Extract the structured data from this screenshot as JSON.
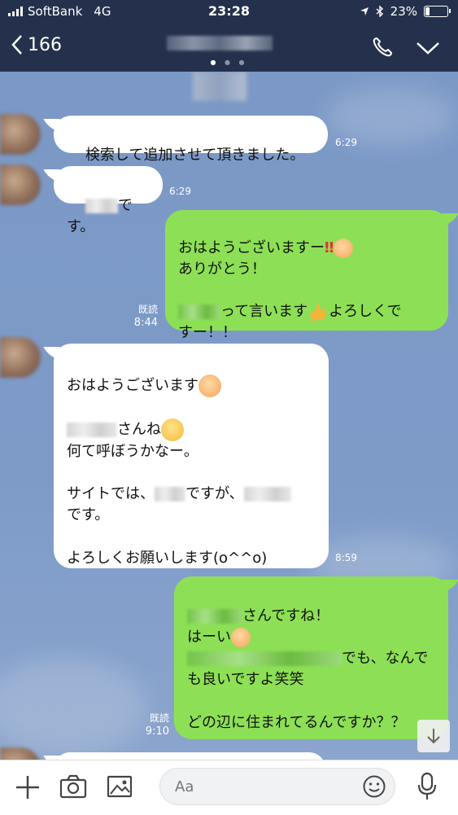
{
  "status": {
    "carrier": "SoftBank",
    "network": "4G",
    "time": "23:28",
    "battery": "23%"
  },
  "header": {
    "back_count": "166"
  },
  "messages": [
    {
      "side": "left",
      "text": "検索して追加させて頂きました。",
      "time": "6:29"
    },
    {
      "side": "left",
      "text": "です。",
      "time": "6:29"
    },
    {
      "side": "right",
      "line1": "おはようございますー",
      "line2": "ありがとう！",
      "line3a": "って言います",
      "line3b": "よろしくで",
      "line4": "すー！！",
      "read": "既読",
      "time": "8:44"
    },
    {
      "side": "left",
      "line1": "おはようございます",
      "line2": "さんね",
      "line3": "何て呼ぼうかなー。",
      "line4a": "サイトでは、",
      "line4b": "ですが、",
      "line5": "です。",
      "line6": "よろしくお願いします(o^^o)",
      "time": "8:59"
    },
    {
      "side": "right",
      "line1": "さんですね！",
      "line2": "はーい",
      "line3": "でも、なんで",
      "line4": "も良いですよ笑笑",
      "line5": "どの辺に住まれてるんですか？？",
      "read": "既読",
      "time": "9:10"
    }
  ],
  "input": {
    "placeholder": "Aa"
  },
  "icons": [
    "back-chevron-icon",
    "phone-icon",
    "chevron-down-icon",
    "plus-icon",
    "camera-icon",
    "image-icon",
    "emoji-icon",
    "microphone-icon",
    "arrow-down-icon"
  ]
}
